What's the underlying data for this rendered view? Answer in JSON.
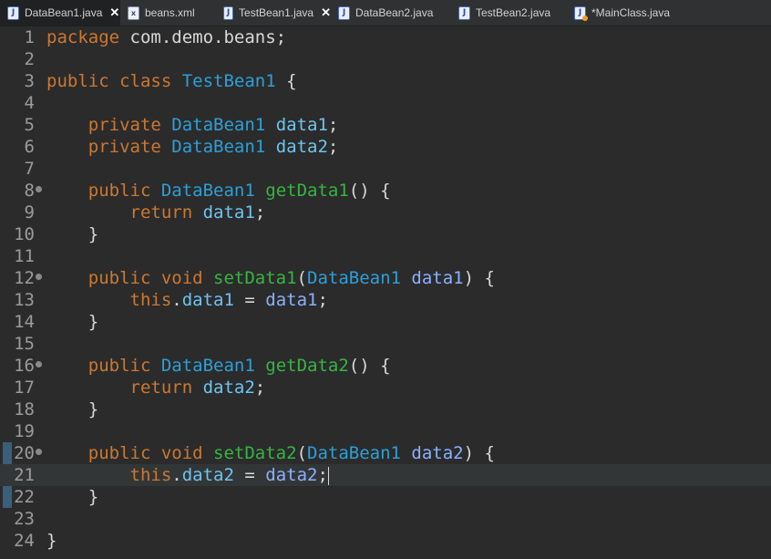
{
  "tabs": [
    {
      "label": "DataBean1.java",
      "icon": "java-file-icon",
      "closable": true,
      "selected": true
    },
    {
      "label": "beans.xml",
      "icon": "xml-file-icon",
      "closable": false,
      "selected": false
    },
    {
      "label": "TestBean1.java",
      "icon": "java-file-icon",
      "closable": true,
      "selected": false
    },
    {
      "label": "DataBean2.java",
      "icon": "java-file-icon",
      "closable": false,
      "selected": false
    },
    {
      "label": "TestBean2.java",
      "icon": "java-file-icon",
      "closable": false,
      "selected": false
    },
    {
      "label": "*MainClass.java",
      "icon": "main-class-file-icon",
      "closable": false,
      "selected": false
    }
  ],
  "close_glyph": "✕",
  "lines": [
    {
      "num": "1",
      "fold": false,
      "tokens": [
        {
          "t": "package ",
          "c": "kw"
        },
        {
          "t": "com.demo.beans;",
          "c": "plain"
        }
      ]
    },
    {
      "num": "2",
      "fold": false,
      "tokens": []
    },
    {
      "num": "3",
      "fold": false,
      "tokens": [
        {
          "t": "public class ",
          "c": "kw"
        },
        {
          "t": "TestBean1",
          "c": "type"
        },
        {
          "t": " {",
          "c": "plain"
        }
      ]
    },
    {
      "num": "4",
      "fold": false,
      "tokens": []
    },
    {
      "num": "5",
      "fold": false,
      "tokens": [
        {
          "t": "    private ",
          "c": "kw"
        },
        {
          "t": "DataBean1",
          "c": "type"
        },
        {
          "t": " ",
          "c": "plain"
        },
        {
          "t": "data1",
          "c": "field"
        },
        {
          "t": ";",
          "c": "plain"
        }
      ]
    },
    {
      "num": "6",
      "fold": false,
      "tokens": [
        {
          "t": "    private ",
          "c": "kw"
        },
        {
          "t": "DataBean1",
          "c": "type"
        },
        {
          "t": " ",
          "c": "plain"
        },
        {
          "t": "data2",
          "c": "field"
        },
        {
          "t": ";",
          "c": "plain"
        }
      ]
    },
    {
      "num": "7",
      "fold": false,
      "tokens": []
    },
    {
      "num": "8",
      "fold": true,
      "tokens": [
        {
          "t": "    public ",
          "c": "kw"
        },
        {
          "t": "DataBean1",
          "c": "type"
        },
        {
          "t": " ",
          "c": "plain"
        },
        {
          "t": "getData1",
          "c": "method"
        },
        {
          "t": "() {",
          "c": "plain"
        }
      ]
    },
    {
      "num": "9",
      "fold": false,
      "tokens": [
        {
          "t": "        return ",
          "c": "kw"
        },
        {
          "t": "data1",
          "c": "field"
        },
        {
          "t": ";",
          "c": "plain"
        }
      ]
    },
    {
      "num": "10",
      "fold": false,
      "tokens": [
        {
          "t": "    }",
          "c": "plain"
        }
      ]
    },
    {
      "num": "11",
      "fold": false,
      "tokens": []
    },
    {
      "num": "12",
      "fold": true,
      "tokens": [
        {
          "t": "    public void ",
          "c": "kw"
        },
        {
          "t": "setData1",
          "c": "method"
        },
        {
          "t": "(",
          "c": "plain"
        },
        {
          "t": "DataBean1",
          "c": "type"
        },
        {
          "t": " ",
          "c": "plain"
        },
        {
          "t": "data1",
          "c": "param"
        },
        {
          "t": ") {",
          "c": "plain"
        }
      ]
    },
    {
      "num": "13",
      "fold": false,
      "tokens": [
        {
          "t": "        this",
          "c": "kw"
        },
        {
          "t": ".",
          "c": "plain"
        },
        {
          "t": "data1",
          "c": "field"
        },
        {
          "t": " = ",
          "c": "plain"
        },
        {
          "t": "data1",
          "c": "param"
        },
        {
          "t": ";",
          "c": "plain"
        }
      ]
    },
    {
      "num": "14",
      "fold": false,
      "tokens": [
        {
          "t": "    }",
          "c": "plain"
        }
      ]
    },
    {
      "num": "15",
      "fold": false,
      "tokens": []
    },
    {
      "num": "16",
      "fold": true,
      "tokens": [
        {
          "t": "    public ",
          "c": "kw"
        },
        {
          "t": "DataBean1",
          "c": "type"
        },
        {
          "t": " ",
          "c": "plain"
        },
        {
          "t": "getData2",
          "c": "method"
        },
        {
          "t": "() {",
          "c": "plain"
        }
      ]
    },
    {
      "num": "17",
      "fold": false,
      "tokens": [
        {
          "t": "        return ",
          "c": "kw"
        },
        {
          "t": "data2",
          "c": "field"
        },
        {
          "t": ";",
          "c": "plain"
        }
      ]
    },
    {
      "num": "18",
      "fold": false,
      "tokens": [
        {
          "t": "    }",
          "c": "plain"
        }
      ]
    },
    {
      "num": "19",
      "fold": false,
      "tokens": []
    },
    {
      "num": "20",
      "fold": true,
      "tokens": [
        {
          "t": "    public void ",
          "c": "kw"
        },
        {
          "t": "setData2",
          "c": "method"
        },
        {
          "t": "(",
          "c": "plain"
        },
        {
          "t": "DataBean1",
          "c": "type"
        },
        {
          "t": " ",
          "c": "plain"
        },
        {
          "t": "data2",
          "c": "param"
        },
        {
          "t": ") {",
          "c": "plain"
        }
      ]
    },
    {
      "num": "21",
      "fold": false,
      "current": true,
      "caret": true,
      "tokens": [
        {
          "t": "        this",
          "c": "kw"
        },
        {
          "t": ".",
          "c": "plain"
        },
        {
          "t": "data2",
          "c": "field"
        },
        {
          "t": " = ",
          "c": "plain"
        },
        {
          "t": "data2",
          "c": "param"
        },
        {
          "t": ";",
          "c": "plain"
        }
      ]
    },
    {
      "num": "22",
      "fold": false,
      "tokens": [
        {
          "t": "    }",
          "c": "plain"
        }
      ]
    },
    {
      "num": "23",
      "fold": false,
      "tokens": []
    },
    {
      "num": "24",
      "fold": false,
      "tokens": [
        {
          "t": "}",
          "c": "plain"
        }
      ]
    }
  ],
  "colors": {
    "background": "#2b2b2b",
    "keyword": "#cc7832",
    "type": "#2d9fd8",
    "field": "#6ec4ef",
    "method": "#36b543",
    "parameter": "#8ab1ff",
    "text": "#d8d8d8",
    "line_number": "#9b9b9b"
  }
}
